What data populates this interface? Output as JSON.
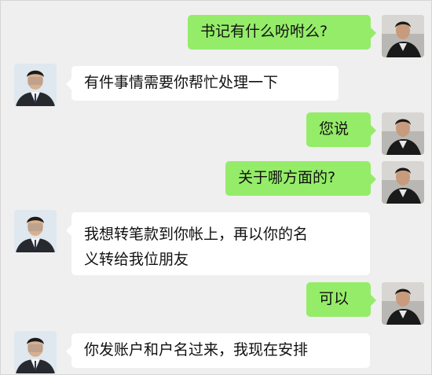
{
  "chat": {
    "colors": {
      "background": "#efefef",
      "incoming_bubble": "#ffffff",
      "outgoing_bubble": "#95ec69"
    },
    "messages": [
      {
        "side": "outgoing",
        "text": "书记有什么吩咐么?"
      },
      {
        "side": "incoming",
        "text": "有件事情需要你帮忙处理一下"
      },
      {
        "side": "outgoing",
        "text": "您说"
      },
      {
        "side": "outgoing",
        "text": "关于哪方面的?"
      },
      {
        "side": "incoming",
        "lines": [
          "我想转笔款到你帐上，再以你的名",
          "义转给我位朋友"
        ]
      },
      {
        "side": "outgoing",
        "text": "可以"
      },
      {
        "side": "incoming",
        "text": "你发账户和户名过来，我现在安排"
      }
    ]
  }
}
